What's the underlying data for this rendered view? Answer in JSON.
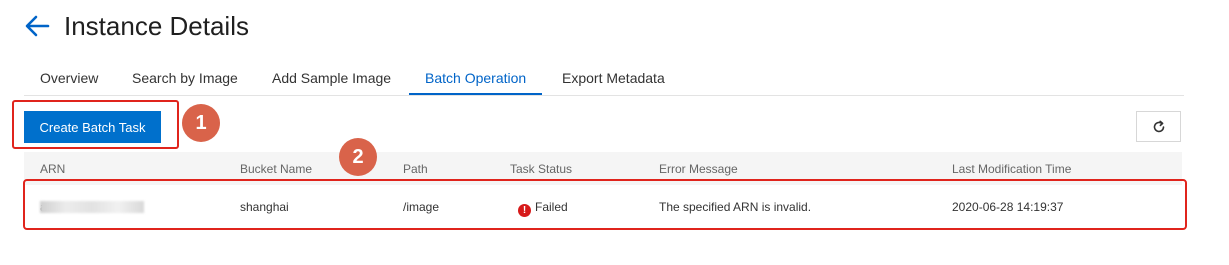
{
  "header": {
    "title": "Instance Details",
    "back_icon": "back-arrow-icon"
  },
  "tabs": [
    {
      "label": "Overview",
      "active": false
    },
    {
      "label": "Search by Image",
      "active": false
    },
    {
      "label": "Add Sample Image",
      "active": false
    },
    {
      "label": "Batch Operation",
      "active": true
    },
    {
      "label": "Export Metadata",
      "active": false
    }
  ],
  "toolbar": {
    "create_label": "Create Batch Task",
    "refresh_icon": "refresh-icon"
  },
  "markers": [
    "1",
    "2"
  ],
  "table": {
    "columns": [
      "ARN",
      "Bucket Name",
      "Path",
      "Task Status",
      "Error Message",
      "Last Modification Time"
    ],
    "rows": [
      {
        "arn": "a",
        "bucket": "shanghai",
        "path": "/image",
        "status": "Failed",
        "error": "The specified ARN is invalid.",
        "modified": "2020-06-28 14:19:37"
      }
    ]
  },
  "colors": {
    "accent": "#0064c8",
    "primary_button": "#0070cc",
    "highlight": "#e0241c",
    "marker": "#d9634a",
    "status_failed": "#d71a1a"
  }
}
